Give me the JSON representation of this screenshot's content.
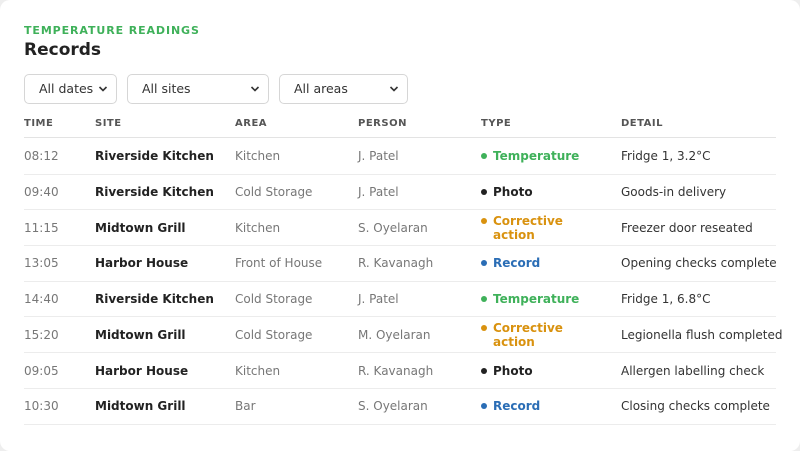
{
  "header": {
    "eyebrow": "TEMPERATURE READINGS",
    "title": "Records"
  },
  "filters": [
    {
      "value": "All dates"
    },
    {
      "value": "All sites"
    },
    {
      "value": "All areas"
    }
  ],
  "columns": [
    "TIME",
    "SITE",
    "AREA",
    "PERSON",
    "TYPE",
    "DETAIL"
  ],
  "type_colors": {
    "Temperature": "#3fb15a",
    "Photo": "#222222",
    "Corrective action": "#d9920f",
    "Record": "#2a6db5"
  },
  "rows": [
    {
      "time": "08:12",
      "site": "Riverside Kitchen",
      "area": "Kitchen",
      "person": "J. Patel",
      "type": "Temperature",
      "detail": "Fridge 1, 3.2°C"
    },
    {
      "time": "09:40",
      "site": "Riverside Kitchen",
      "area": "Cold Storage",
      "person": "J. Patel",
      "type": "Photo",
      "detail": "Goods-in delivery"
    },
    {
      "time": "11:15",
      "site": "Midtown Grill",
      "area": "Kitchen",
      "person": "S. Oyelaran",
      "type": "Corrective action",
      "detail": "Freezer door reseated"
    },
    {
      "time": "13:05",
      "site": "Harbor House",
      "area": "Front of House",
      "person": "R. Kavanagh",
      "type": "Record",
      "detail": "Opening checks complete"
    },
    {
      "time": "14:40",
      "site": "Riverside Kitchen",
      "area": "Cold Storage",
      "person": "J. Patel",
      "type": "Temperature",
      "detail": "Fridge 1, 6.8°C"
    },
    {
      "time": "15:20",
      "site": "Midtown Grill",
      "area": "Cold Storage",
      "person": "M. Oyelaran",
      "type": "Corrective action",
      "detail": "Legionella flush completed"
    },
    {
      "time": "09:05",
      "site": "Harbor House",
      "area": "Kitchen",
      "person": "R. Kavanagh",
      "type": "Photo",
      "detail": "Allergen labelling check"
    },
    {
      "time": "10:30",
      "site": "Midtown Grill",
      "area": "Bar",
      "person": "S. Oyelaran",
      "type": "Record",
      "detail": "Closing checks complete"
    }
  ]
}
